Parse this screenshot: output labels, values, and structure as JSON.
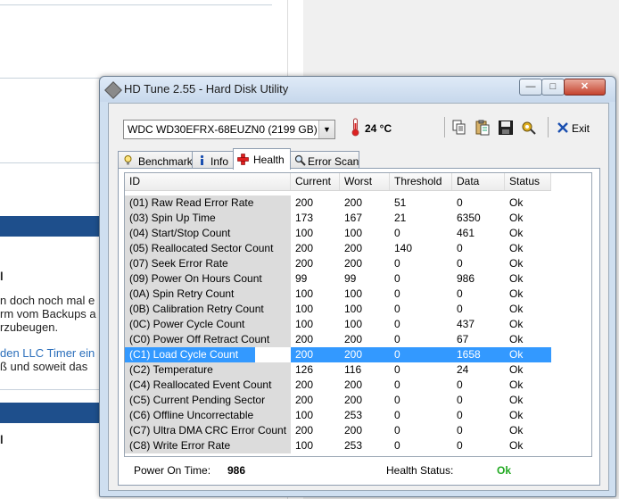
{
  "background": {
    "text_lines": [
      "n doch noch mal e",
      "rm vom Backups a",
      "rzubeugen."
    ],
    "link_text": "den LLC Timer ein",
    "text_after_link": "ß und soweit das",
    "bold_marker_1": "l",
    "bold_marker_2": "l"
  },
  "window": {
    "title": "HD Tune 2.55 - Hard Disk Utility",
    "minimize_glyph": "—",
    "maximize_glyph": "□",
    "close_glyph": "✕"
  },
  "toolbar": {
    "drive": "WDC WD30EFRX-68EUZN0 (2199 GB)",
    "temperature": "24 °C",
    "exit_label": "Exit",
    "exit_icon": "x-icon"
  },
  "tabs": [
    {
      "label": "Benchmark",
      "icon": "lightbulb-icon"
    },
    {
      "label": "Info",
      "icon": "info-icon"
    },
    {
      "label": "Health",
      "icon": "red-cross-icon",
      "active": true
    },
    {
      "label": "Error Scan",
      "icon": "magnifier-icon"
    }
  ],
  "table": {
    "columns": [
      "ID",
      "Current",
      "Worst",
      "Threshold",
      "Data",
      "Status"
    ],
    "rows": [
      {
        "id": "(01) Raw Read Error Rate",
        "current": "200",
        "worst": "200",
        "threshold": "51",
        "data": "0",
        "status": "Ok"
      },
      {
        "id": "(03) Spin Up Time",
        "current": "173",
        "worst": "167",
        "threshold": "21",
        "data": "6350",
        "status": "Ok"
      },
      {
        "id": "(04) Start/Stop Count",
        "current": "100",
        "worst": "100",
        "threshold": "0",
        "data": "461",
        "status": "Ok"
      },
      {
        "id": "(05) Reallocated Sector Count",
        "current": "200",
        "worst": "200",
        "threshold": "140",
        "data": "0",
        "status": "Ok"
      },
      {
        "id": "(07) Seek Error Rate",
        "current": "200",
        "worst": "200",
        "threshold": "0",
        "data": "0",
        "status": "Ok"
      },
      {
        "id": "(09) Power On Hours Count",
        "current": "99",
        "worst": "99",
        "threshold": "0",
        "data": "986",
        "status": "Ok"
      },
      {
        "id": "(0A) Spin Retry Count",
        "current": "100",
        "worst": "100",
        "threshold": "0",
        "data": "0",
        "status": "Ok"
      },
      {
        "id": "(0B) Calibration Retry Count",
        "current": "100",
        "worst": "100",
        "threshold": "0",
        "data": "0",
        "status": "Ok"
      },
      {
        "id": "(0C) Power Cycle Count",
        "current": "100",
        "worst": "100",
        "threshold": "0",
        "data": "437",
        "status": "Ok"
      },
      {
        "id": "(C0) Power Off Retract Count",
        "current": "200",
        "worst": "200",
        "threshold": "0",
        "data": "67",
        "status": "Ok"
      },
      {
        "id": "(C1) Load Cycle Count",
        "current": "200",
        "worst": "200",
        "threshold": "0",
        "data": "1658",
        "status": "Ok",
        "selected": true
      },
      {
        "id": "(C2) Temperature",
        "current": "126",
        "worst": "116",
        "threshold": "0",
        "data": "24",
        "status": "Ok"
      },
      {
        "id": "(C4) Reallocated Event Count",
        "current": "200",
        "worst": "200",
        "threshold": "0",
        "data": "0",
        "status": "Ok"
      },
      {
        "id": "(C5) Current Pending Sector",
        "current": "200",
        "worst": "200",
        "threshold": "0",
        "data": "0",
        "status": "Ok"
      },
      {
        "id": "(C6) Offline Uncorrectable",
        "current": "100",
        "worst": "253",
        "threshold": "0",
        "data": "0",
        "status": "Ok"
      },
      {
        "id": "(C7) Ultra DMA CRC Error Count",
        "current": "200",
        "worst": "200",
        "threshold": "0",
        "data": "0",
        "status": "Ok"
      },
      {
        "id": "(C8) Write Error Rate",
        "current": "100",
        "worst": "253",
        "threshold": "0",
        "data": "0",
        "status": "Ok"
      }
    ]
  },
  "footer": {
    "power_on_label": "Power On Time:",
    "power_on_value": "986",
    "health_label": "Health Status:",
    "health_value": "Ok"
  },
  "colors": {
    "selection": "#3399ff",
    "health_ok": "#22aa22",
    "web_bar": "#1e4f8c"
  }
}
